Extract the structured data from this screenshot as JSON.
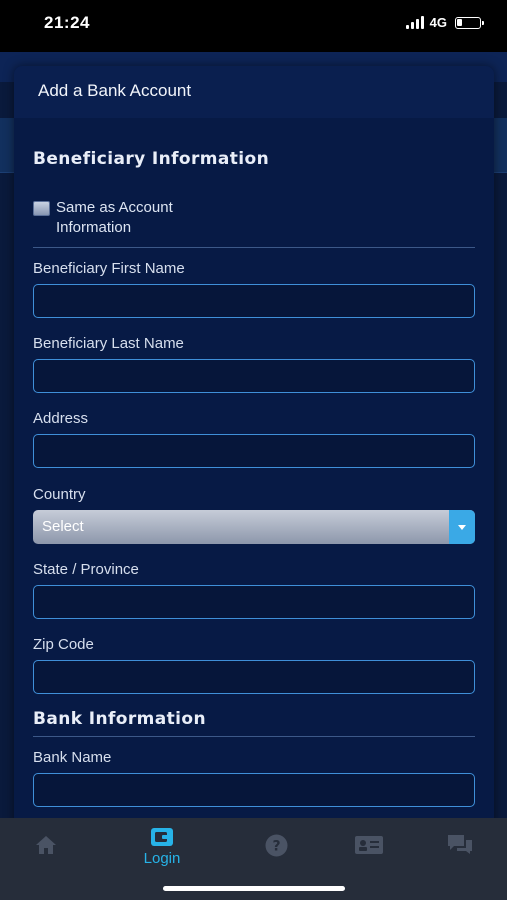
{
  "status_bar": {
    "time": "21:24",
    "network": "4G"
  },
  "modal": {
    "title": "Add a Bank Account",
    "beneficiary_section": "Beneficiary Information",
    "same_as_account": "Same as Account Information",
    "fields": {
      "first_name": {
        "label": "Beneficiary First Name",
        "value": ""
      },
      "last_name": {
        "label": "Beneficiary Last Name",
        "value": ""
      },
      "address": {
        "label": "Address",
        "value": ""
      },
      "country": {
        "label": "Country",
        "selected": "Select"
      },
      "state": {
        "label": "State / Province",
        "value": ""
      },
      "zip": {
        "label": "Zip Code",
        "value": ""
      }
    },
    "bank_section": "Bank Information",
    "bank_fields": {
      "bank_name": {
        "label": "Bank Name",
        "value": ""
      }
    }
  },
  "tabbar": {
    "items": [
      {
        "icon": "home-icon",
        "label": ""
      },
      {
        "icon": "wallet-icon",
        "label": "Login"
      },
      {
        "icon": "help-icon",
        "label": ""
      },
      {
        "icon": "id-card-icon",
        "label": ""
      },
      {
        "icon": "chat-icon",
        "label": ""
      }
    ]
  },
  "colors": {
    "accent": "#27b3e8",
    "input_border": "#3f8fd8",
    "modal_bg": "#071a45"
  }
}
